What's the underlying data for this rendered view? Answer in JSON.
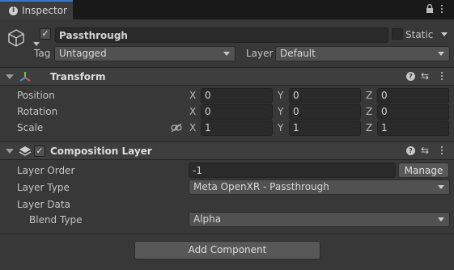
{
  "window": {
    "tab_label": "Inspector",
    "tab_icon": "info-icon",
    "lock_icon": "lock-icon",
    "menu_icon": "kebab-menu-icon"
  },
  "gameobject": {
    "active": true,
    "name": "Passthrough",
    "static_label": "Static",
    "static_checked": false,
    "tag_label": "Tag",
    "tag_value": "Untagged",
    "layer_label": "Layer",
    "layer_value": "Default",
    "icon": "cube-icon"
  },
  "transform": {
    "title": "Transform",
    "icon": "transform-axes-icon",
    "rows": [
      {
        "label": "Position",
        "x": "0",
        "y": "0",
        "z": "0"
      },
      {
        "label": "Rotation",
        "x": "0",
        "y": "0",
        "z": "0"
      },
      {
        "label": "Scale",
        "x": "1",
        "y": "1",
        "z": "1"
      }
    ],
    "axis_labels": [
      "X",
      "Y",
      "Z"
    ]
  },
  "composition_layer": {
    "title": "Composition Layer",
    "enabled": true,
    "icon": "layers-icon",
    "layer_order_label": "Layer Order",
    "layer_order_value": "-1",
    "manage_label": "Manage",
    "layer_type_label": "Layer Type",
    "layer_type_value": "Meta OpenXR - Passthrough",
    "layer_data_label": "Layer Data",
    "blend_type_label": "Blend Type",
    "blend_type_value": "Alpha"
  },
  "footer": {
    "add_component_label": "Add Component"
  },
  "colors": {
    "tab_accent": "#3a79bb",
    "panel_bg": "#383838",
    "field_bg": "#2a2a2a",
    "button_bg": "#585858"
  }
}
